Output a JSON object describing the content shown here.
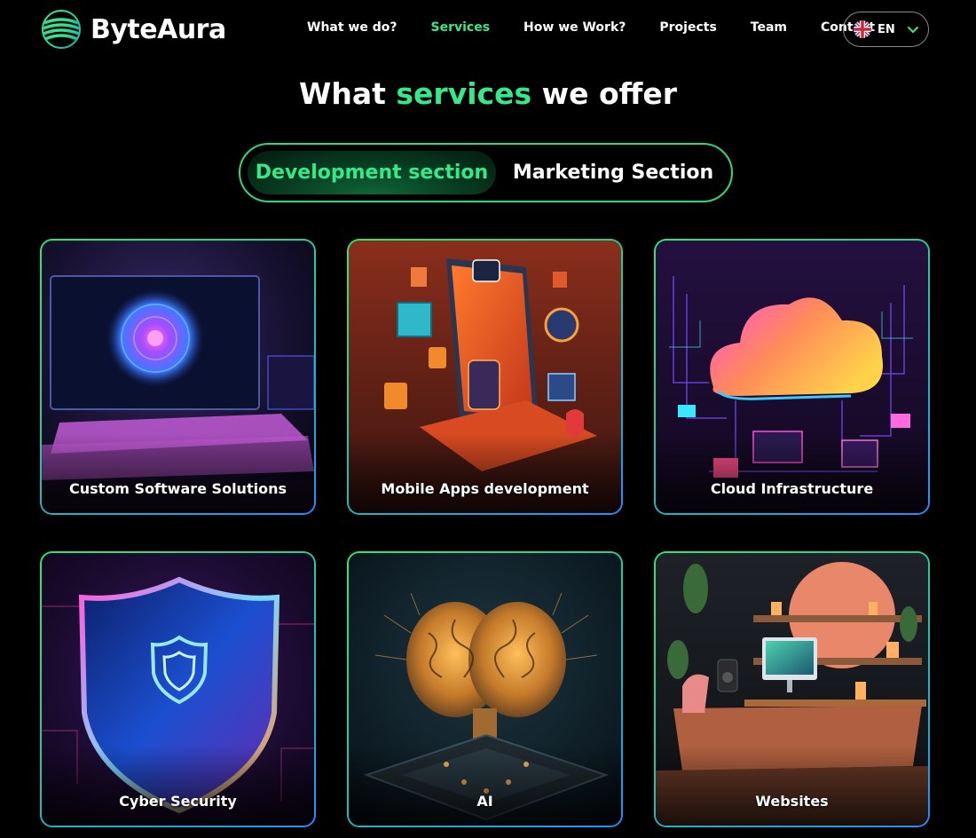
{
  "header": {
    "brand": "ByteAura",
    "nav": [
      {
        "label": "What we do?",
        "active": false
      },
      {
        "label": "Services",
        "active": true
      },
      {
        "label": "How we Work?",
        "active": false
      },
      {
        "label": "Projects",
        "active": false
      },
      {
        "label": "Team",
        "active": false
      },
      {
        "label": "Contact",
        "active": false
      }
    ],
    "language": {
      "code": "EN",
      "flag_icon": "uk-flag-icon"
    }
  },
  "section": {
    "title_before": "What ",
    "title_accent": "services",
    "title_after": " we offer"
  },
  "toggle": {
    "selected": "Development section",
    "options": [
      "Development section",
      "Marketing Section"
    ]
  },
  "services": [
    {
      "title": "Custom Software Solutions"
    },
    {
      "title": "Mobile Apps development"
    },
    {
      "title": "Cloud Infrastructure"
    },
    {
      "title": "Cyber Security"
    },
    {
      "title": "AI"
    },
    {
      "title": "Websites"
    }
  ],
  "colors": {
    "accent": "#34e98a",
    "background": "#000000",
    "card_border_start": "#2ee86f",
    "card_border_end": "#1f8fff"
  }
}
